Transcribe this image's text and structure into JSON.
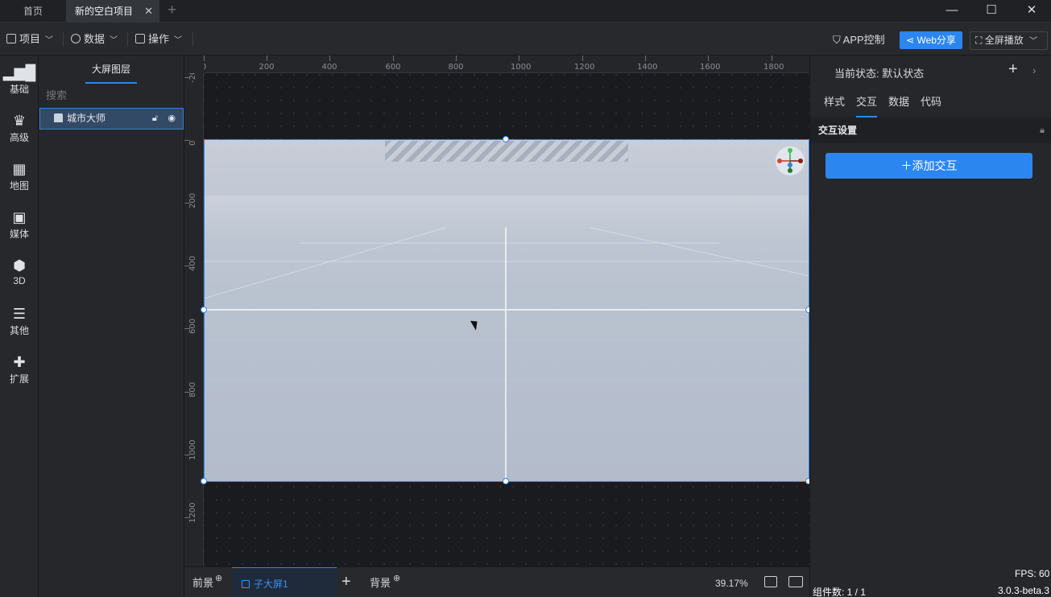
{
  "titlebar": {
    "home_tab": "首页",
    "project_tab": "新的空白项目",
    "close_glyph": "✕",
    "add_tab_glyph": "+",
    "win_min": "—",
    "win_max": "☐",
    "win_close": "✕"
  },
  "toolbar": {
    "project_menu": "项目",
    "data_menu": "数据",
    "ops_menu": "操作",
    "app_control": "APP控制",
    "web_share": "Web分享",
    "fullscreen": "全屏播放"
  },
  "leftbar": {
    "items": [
      {
        "label": "基础",
        "icon": "bar-chart-icon"
      },
      {
        "label": "高级",
        "icon": "crown-icon"
      },
      {
        "label": "地图",
        "icon": "map-icon"
      },
      {
        "label": "媒体",
        "icon": "camera-icon"
      },
      {
        "label": "3D",
        "icon": "cube-icon"
      },
      {
        "label": "其他",
        "icon": "list-icon"
      },
      {
        "label": "扩展",
        "icon": "puzzle-icon"
      }
    ]
  },
  "layers": {
    "title": "大屏图层",
    "search_placeholder": "搜索",
    "items": [
      {
        "name": "城市大师",
        "locked": false,
        "visible": true
      }
    ]
  },
  "canvas": {
    "ruler_h": [
      "0",
      "200",
      "400",
      "600",
      "800",
      "1000",
      "1200",
      "1400",
      "1600",
      "1800"
    ],
    "ruler_v": [
      "-200",
      "0",
      "200",
      "400",
      "600",
      "800",
      "1000",
      "1200"
    ]
  },
  "bottombar": {
    "foreground": "前景",
    "sub_screen": "子大屏1",
    "background": "背景",
    "zoom": "39.17%"
  },
  "rightpanel": {
    "status": "当前状态:  默认状态",
    "tabs": [
      "样式",
      "交互",
      "数据",
      "代码"
    ],
    "active_tab": "交互",
    "section_title": "交互设置",
    "add_button": "＋添加交互",
    "fps": "FPS: 60",
    "component_count": "组件数: 1 / 1",
    "version": "3.0.3-beta.3"
  },
  "colors": {
    "accent": "#2b86f0",
    "panel": "#25272b",
    "canvas": "#1a1b1e"
  }
}
